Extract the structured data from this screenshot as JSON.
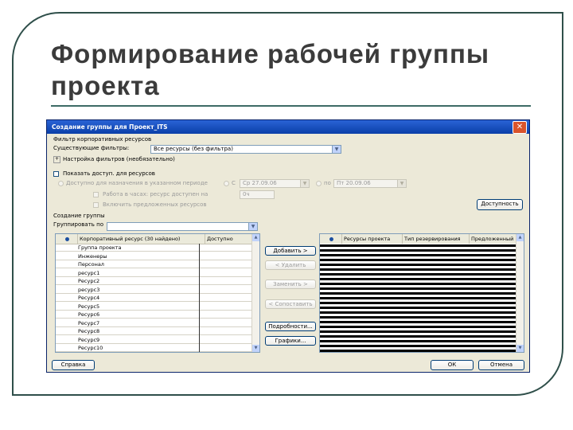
{
  "slide": {
    "title_line1": "Формирование рабочей группы",
    "title_line2": "проекта"
  },
  "dialog": {
    "title": "Создание группы для Проект_ITS",
    "close_glyph": "✕",
    "section_filter": "Фильтр корпоративных ресурсов",
    "existing_filters_label": "Существующие фильтры:",
    "existing_filter_value": "Все ресурсы (без фильтра)",
    "custom_filters_label": "Настройка фильтров (необязательно)",
    "availability_checkbox_label": "Показать доступ. для ресурсов",
    "radio_availability": "Доступно для назначения в указанном периоде",
    "period_from_label": "С",
    "period_from_value": "Ср 27.09.06",
    "period_to_label": "по",
    "period_to_value": "Пт 20.09.06",
    "chk_hours_label": "Работа в часах: ресурс доступен на",
    "hours_value": "0ч",
    "chk_include_label": "Включить предложенных ресурсов",
    "availability_button": "Доступность",
    "section_group": "Создание группы",
    "group_by_label": "Группировать по",
    "group_by_value": "",
    "info_glyph": "●",
    "left_grid": {
      "col_resource": "Корпоративный ресурс (30 найдено)",
      "col_available": "Доступно",
      "rows": [
        "Группа проекта",
        "Инженеры",
        "Персонал",
        "ресурс1",
        "Ресурс2",
        "ресурс3",
        "Ресурс4",
        "Ресурс5",
        "Ресурс6",
        "Ресурс7",
        "Ресурс8",
        "Ресурс9",
        "Ресурс10"
      ]
    },
    "right_grid": {
      "col_resource": "Ресурсы проекта",
      "col_booking": "Тип резервирования",
      "col_proposed": "Предложенный"
    },
    "buttons": {
      "add": "Добавить >",
      "remove": "< Удалить",
      "replace": "Заменить >",
      "match": "< Сопоставить",
      "details": "Подробности...",
      "graphs": "Графики...",
      "help": "Справка",
      "ok": "ОК",
      "cancel": "Отмена"
    }
  }
}
